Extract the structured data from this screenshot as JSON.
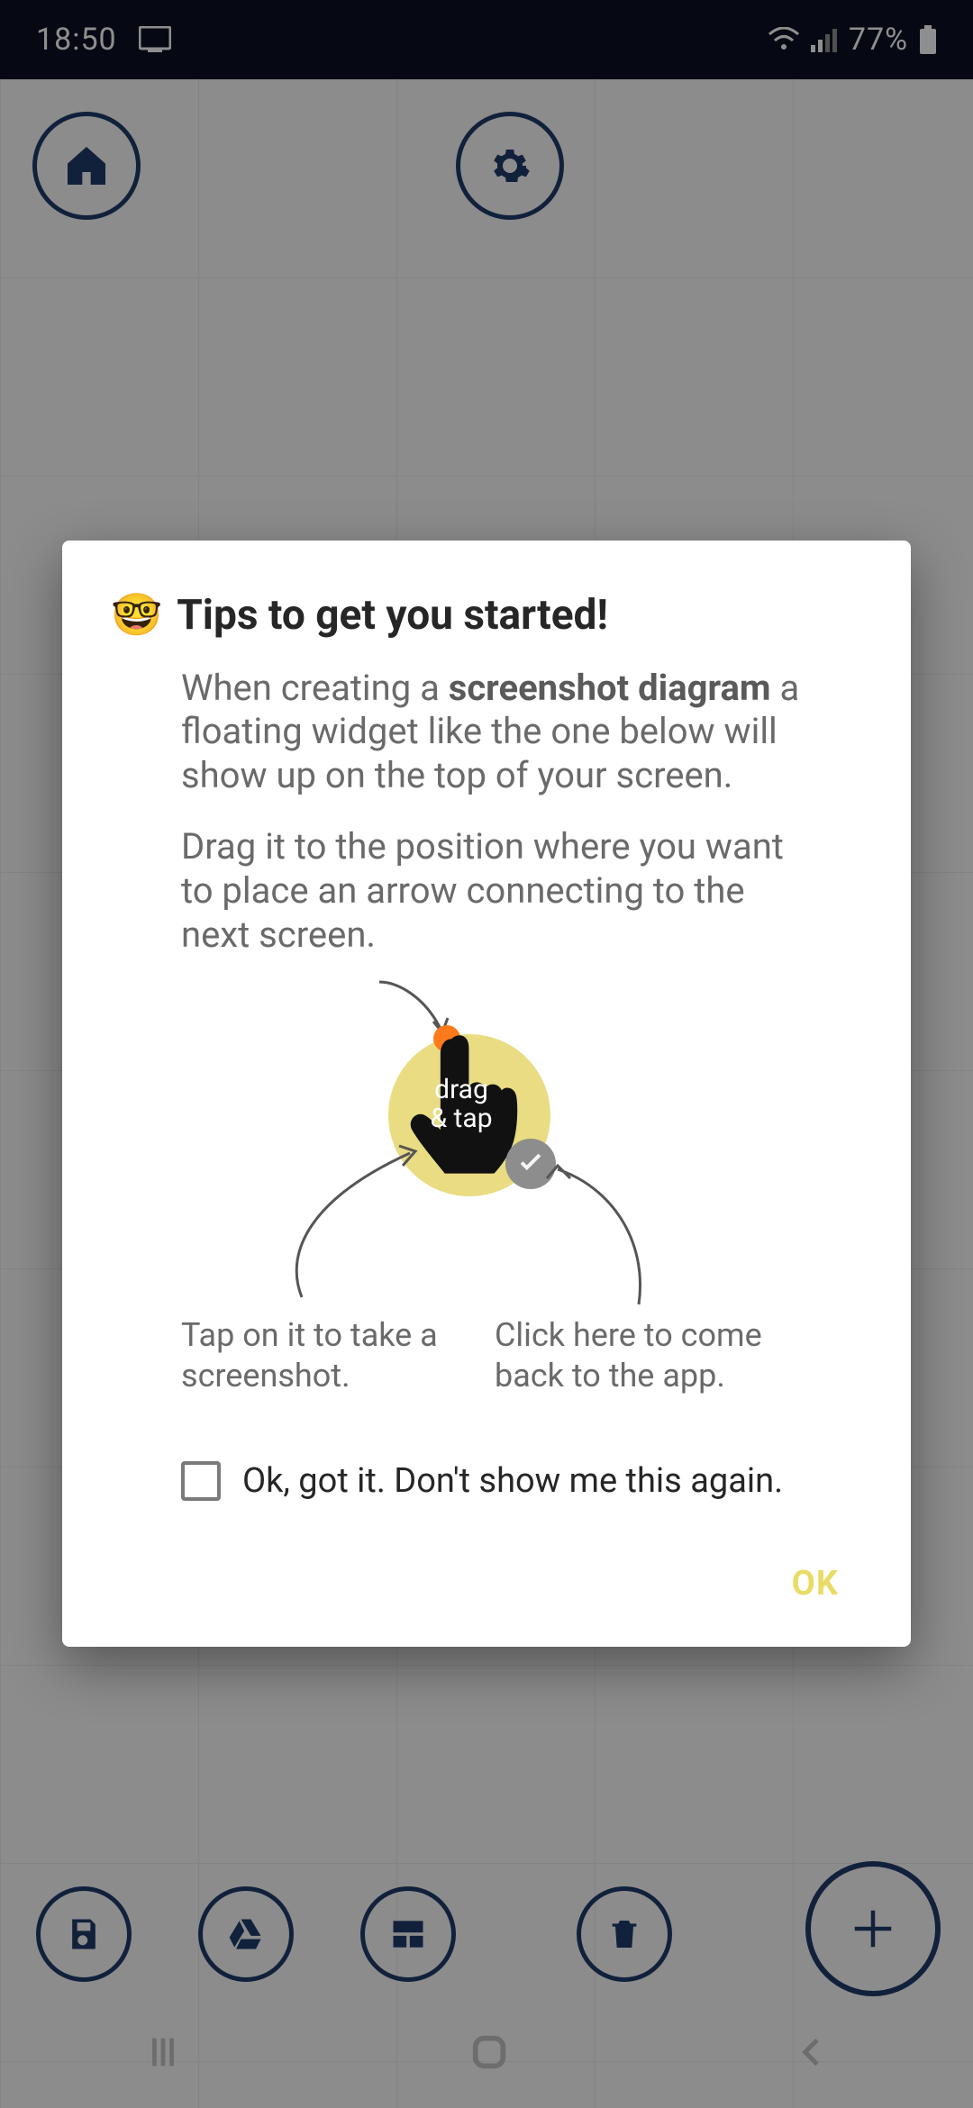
{
  "statusbar": {
    "time": "18:50",
    "battery_pct": "77%"
  },
  "dialog": {
    "title_emoji": "🤓",
    "title": "Tips to get you started!",
    "para1_prefix": "When creating a ",
    "para1_bold": "screenshot diagram",
    "para1_suffix": " a floating widget like the one below will show up on the top of your screen.",
    "para2": "Drag it to the position where you want to place an arrow connecting to the next screen.",
    "widget_label_line1": "drag",
    "widget_label_line2": "& tap",
    "caption_left": "Tap on it to take a screenshot.",
    "caption_right": "Click here to come back to the app.",
    "checkbox_label": "Ok, got it. Don't show me this again.",
    "ok_label": "OK"
  }
}
